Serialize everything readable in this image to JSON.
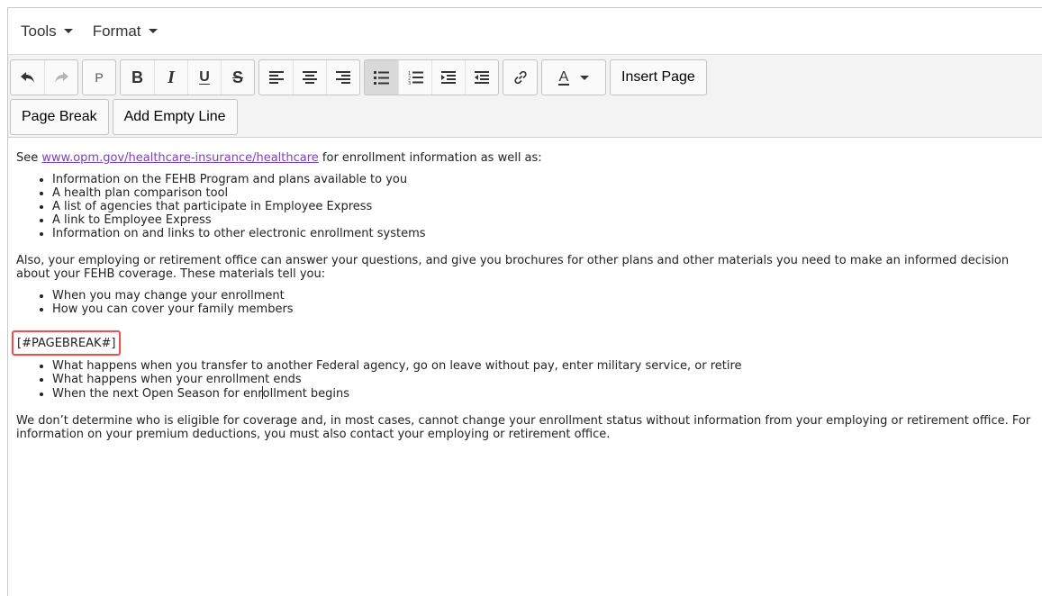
{
  "menubar": {
    "tools_label": "Tools",
    "format_label": "Format"
  },
  "toolbar": {
    "paragraph_label": "P",
    "bold_label": "B",
    "italic_label": "I",
    "underline_label": "U",
    "strike_label": "S",
    "font_color_label": "A",
    "insert_page_label": "Insert Page",
    "page_break_label": "Page Break",
    "add_empty_line_label": "Add Empty Line",
    "active_tool": "bullet-list",
    "icon_names": [
      "undo-icon",
      "redo-icon",
      "align-left-icon",
      "align-center-icon",
      "align-right-icon",
      "bullet-list-icon",
      "numbered-list-icon",
      "indent-icon",
      "outdent-icon",
      "link-icon",
      "chevron-down-icon"
    ]
  },
  "content": {
    "intro_prefix": "See ",
    "intro_link": "www.opm.gov/healthcare-insurance/healthcare",
    "intro_suffix": "  for enrollment information as well as:",
    "list1": [
      "Information on the FEHB Program and plans available to you",
      "A health plan comparison tool",
      "A list of agencies that participate in Employee Express",
      "A link to Employee Express",
      "Information on and links to other electronic enrollment systems"
    ],
    "para2": "Also, your employing or retirement office can answer your questions, and give you brochures for other plans and other materials you need to make an informed decision about your FEHB coverage.  These materials tell you:",
    "list2": [
      "When you may change your enrollment",
      "How you can cover your family members"
    ],
    "page_break_token": "[#PAGEBREAK#]",
    "list3": [
      "What happens when you transfer to another Federal agency, go on leave without pay, enter military service, or retire",
      "What happens when your enrollment ends"
    ],
    "list3_last_before_cursor": "When the next Open Season for enr",
    "list3_last_after_cursor": "ollment begins",
    "para3": "We don’t determine who is eligible for coverage and, in most cases, cannot change your enrollment status without information from your employing or retirement office.  For information on your premium deductions, you must also contact your employing or retirement office.",
    "highlight_color": "#e25555",
    "link_color": "#7b44b6"
  }
}
